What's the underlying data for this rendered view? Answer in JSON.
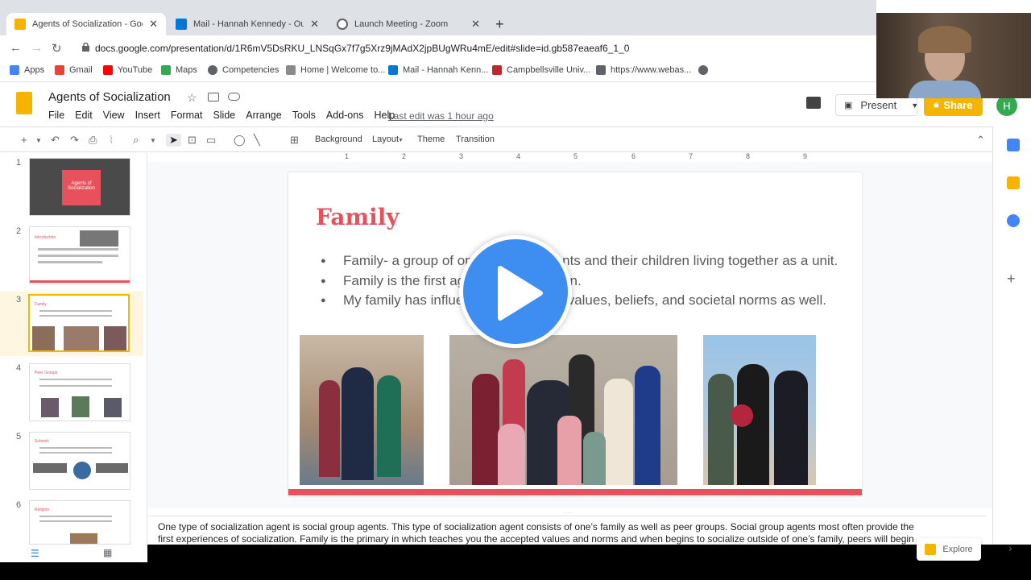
{
  "browser": {
    "tabs": [
      {
        "title": "Agents of Socialization - Google",
        "active": true,
        "color": "#f4b400"
      },
      {
        "title": "Mail - Hannah Kennedy - Outloo",
        "active": false,
        "color": "#0078d4"
      },
      {
        "title": "Launch Meeting - Zoom",
        "active": false,
        "color": "#5f6368"
      }
    ],
    "url": "docs.google.com/presentation/d/1R6mV5DsRKU_LNSqGx7f7g5Xrz9jMAdX2jpBUgWRu4mE/edit#slide=id.gb587eaeaf6_1_0",
    "bookmarks": [
      {
        "label": "Apps",
        "color": "#4285f4"
      },
      {
        "label": "Gmail",
        "color": "#ea4335"
      },
      {
        "label": "YouTube",
        "color": "#ff0000"
      },
      {
        "label": "Maps",
        "color": "#34a853"
      },
      {
        "label": "Competencies",
        "color": "#5f6368"
      },
      {
        "label": "Home | Welcome to...",
        "color": "#5f6368"
      },
      {
        "label": "Mail - Hannah Kenn...",
        "color": "#0078d4"
      },
      {
        "label": "Campbellsville Univ...",
        "color": "#c1272d"
      },
      {
        "label": "https://www.webas...",
        "color": "#5f6368"
      }
    ]
  },
  "slides_app": {
    "doc_title": "Agents of Socialization",
    "menu": [
      "File",
      "Edit",
      "View",
      "Insert",
      "Format",
      "Slide",
      "Arrange",
      "Tools",
      "Add-ons",
      "Help"
    ],
    "last_edit": "Last edit was 1 hour ago",
    "present_label": "Present",
    "share_label": "Share",
    "avatar_letter": "H",
    "toolbar": {
      "background": "Background",
      "layout": "Layout",
      "theme": "Theme",
      "transition": "Transition"
    },
    "ruler_ticks": [
      "1",
      "2",
      "3",
      "4",
      "5",
      "6",
      "7",
      "8",
      "9"
    ],
    "thumbnails": [
      {
        "num": "1",
        "title": "Agents of Socialization"
      },
      {
        "num": "2",
        "title": "Introduction"
      },
      {
        "num": "3",
        "title": "Family"
      },
      {
        "num": "4",
        "title": "Peer Groups"
      },
      {
        "num": "5",
        "title": "Schools"
      },
      {
        "num": "6",
        "title": "Religion"
      }
    ],
    "selected_slide": 3,
    "slide": {
      "title": "Family",
      "bullets": [
        "Family- a group of one or more parents and their children living together as a unit.",
        "Family is the first agent of socialization.",
        "My family has influenced my morals, values, beliefs, and societal norms as well."
      ]
    },
    "notes": "One type of socialization agent is social group agents. This type of socialization agent consists of one’s family as well as peer groups. Social group agents most often provide the first experiences of socialization. Family is the primary in which teaches you the accepted values and norms and when begins to socialize outside of one’s family, peers will begin to influence one’s values and norms as well. People first learn to use tangible objects of material culture with one’s family as well as being introduced to beliefs and value systems. My family has taught me to always treat people with respect, to work hard, and to help others. My family has also taught me how to be a responsible adult.",
    "explore_label": "Explore"
  }
}
